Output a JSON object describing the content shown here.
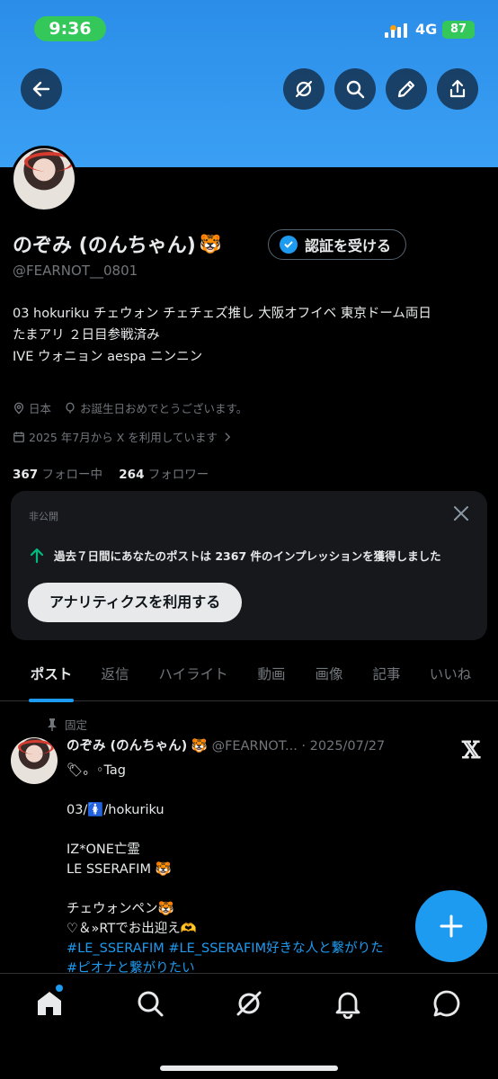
{
  "status_bar": {
    "time": "9:36",
    "network": "4G",
    "battery": "87"
  },
  "profile": {
    "display_name": "のぞみ (のんちゃん)",
    "name_emoji": "🐯",
    "verify_label": "認証を受ける",
    "handle": "@FEARNOT__0801",
    "bio_lines": [
      "03 hokuriku チェウォン チェチェズ推し 大阪オフイベ 東京ドーム両日",
      "たまアリ ２日目参戦済み",
      "",
      "IVE ウォニョン aespa ニンニン"
    ],
    "location": "日本",
    "birthday": "お誕生日おめでとうございます。",
    "joined": "2025 年7月から X を利用しています",
    "following_count": "367",
    "following_label": "フォロー中",
    "followers_count": "264",
    "followers_label": "フォロワー"
  },
  "analytics_card": {
    "private_label": "非公開",
    "message": "過去７日間にあなたのポストは 2367 件のインプレッションを獲得しました",
    "button_label": "アナリティクスを利用する"
  },
  "tabs": [
    "ポスト",
    "返信",
    "ハイライト",
    "動画",
    "画像",
    "記事",
    "いいね"
  ],
  "pinned_post": {
    "pinned_label": "固定",
    "author": "のぞみ (のんちゃん)",
    "author_emoji": "🐯",
    "handle_date": "@FEARNOT... · 2025/07/27",
    "lines": [
      "🏷。◦Tag",
      "",
      "03/🚺/hokuriku",
      "",
      "IZ*ONE亡霊",
      "LE SSERAFIM 🐯",
      "",
      "チェウォンペン🐯",
      "♡＆»RTでお出迎え🫶"
    ],
    "hashtags_line1": "#LE_SSERAFIM  #LE_SSERAFIM好きな人と繋がりた",
    "hashtags_line2": "#ピオナと繋がりたい"
  },
  "colors": {
    "accent": "#1d9bf0",
    "banner": "#3aa0f4",
    "background": "#000000"
  },
  "icons": {
    "top_bar": [
      "back-arrow-icon",
      "grok-icon",
      "search-icon",
      "edit-pencil-icon",
      "share-icon"
    ],
    "bottom_nav": [
      "home-icon",
      "search-icon",
      "grok-icon",
      "notifications-bell-icon",
      "messages-icon"
    ]
  }
}
